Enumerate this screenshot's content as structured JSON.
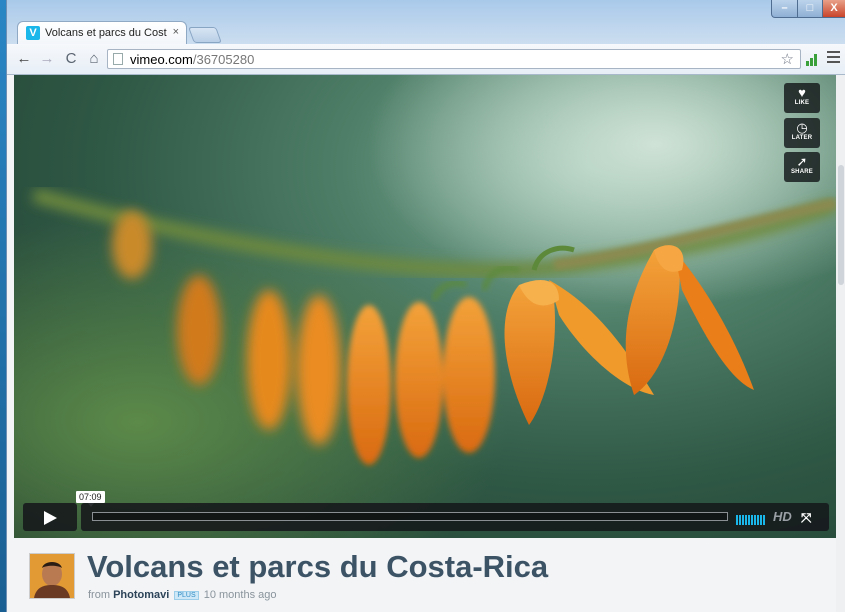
{
  "browser": {
    "tab_title": "Volcans et parcs du Costa",
    "tab_favicon_letter": "V",
    "tab_close": "×",
    "url_host": "vimeo.com",
    "url_path": "/36705280",
    "nav": {
      "back": "←",
      "forward": "→",
      "reload": "C",
      "home": "⌂"
    },
    "star": "☆",
    "window_controls": {
      "minimize": "–",
      "maximize": "□",
      "close": "X"
    }
  },
  "player": {
    "side_buttons": [
      {
        "glyph": "♥",
        "label": "LIKE"
      },
      {
        "glyph": "◷",
        "label": "LATER"
      },
      {
        "glyph": "➚",
        "label": "SHARE"
      }
    ],
    "timecode": "07:09",
    "progress": 0.0,
    "hd_label": "HD",
    "fullscreen_glyph": "⤧",
    "accent_color": "#1ab7ea"
  },
  "video": {
    "title": "Volcans et parcs du Costa-Rica",
    "from_label": "from",
    "author": "Photomavi",
    "badge": "PLUS",
    "age": "10 months ago"
  }
}
